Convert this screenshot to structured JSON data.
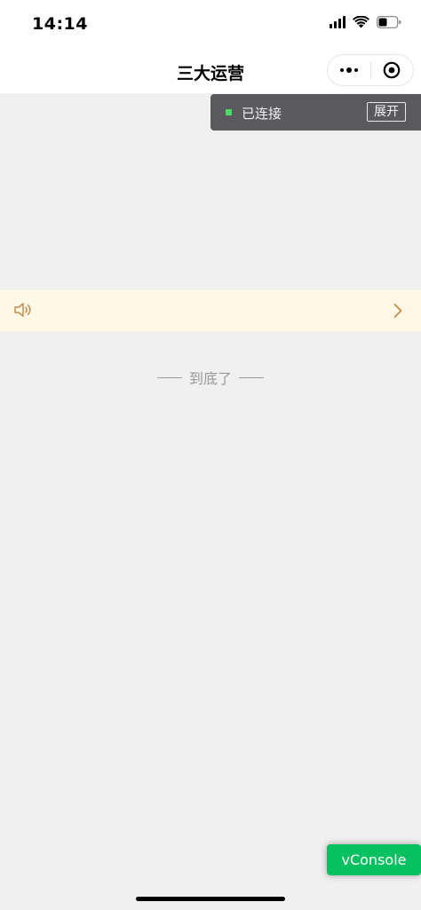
{
  "status_bar": {
    "time": "14:14",
    "icons": [
      "signal-icon",
      "wifi-icon",
      "battery-icon"
    ]
  },
  "nav_bar": {
    "title": "三大运营",
    "capsule": {
      "more_icon": "more-dots-icon",
      "close_icon": "target-close-icon"
    }
  },
  "connection_panel": {
    "status_text": "已连接",
    "expand_label": "展开",
    "status_color": "#4cd964"
  },
  "notice_bar": {
    "icon": "speaker-icon",
    "chevron": "chevron-right-icon",
    "text": "",
    "accent_color": "#c98b4a"
  },
  "list": {
    "end_hint": "到底了"
  },
  "vconsole": {
    "label": "vConsole",
    "color": "#07c160"
  }
}
